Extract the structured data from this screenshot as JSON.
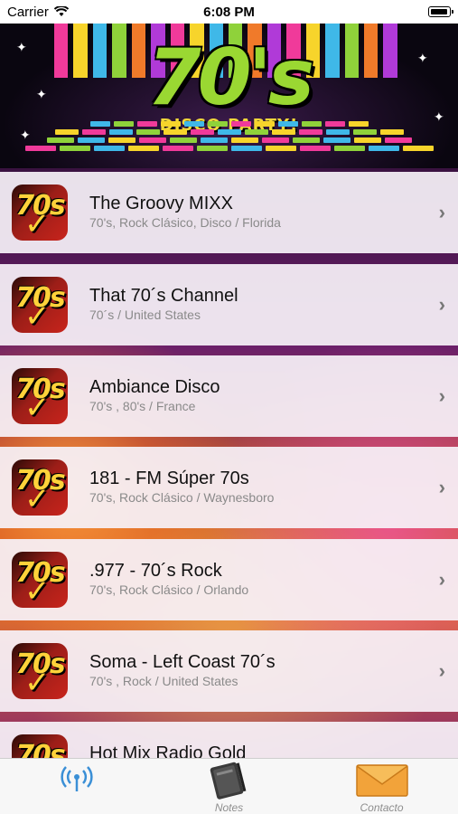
{
  "status_bar": {
    "carrier": "Carrier",
    "time": "6:08 PM"
  },
  "banner": {
    "title": "70's",
    "subtitle": "DISCO PARTY!"
  },
  "stations": [
    {
      "name": "The Groovy MIXX",
      "details": "70's, Rock Clásico, Disco / Florida",
      "icon": "70s-logo-icon"
    },
    {
      "name": "That 70´s Channel",
      "details": "70´s / United States",
      "icon": "70s-logo-icon"
    },
    {
      "name": "Ambiance Disco",
      "details": "70's , 80's / France",
      "icon": "70s-logo-icon"
    },
    {
      "name": "181 - FM Súper 70s",
      "details": "70's, Rock Clásico / Waynesboro",
      "icon": "70s-logo-icon"
    },
    {
      "name": ".977 - 70´s Rock",
      "details": "70's, Rock Clásico / Orlando",
      "icon": "70s-logo-icon"
    },
    {
      "name": "Soma - Left Coast 70´s",
      "details": "70's , Rock / United States",
      "icon": "70s-logo-icon"
    },
    {
      "name": "Hot Mix Radio Gold",
      "details": "",
      "icon": "70s-logo-icon"
    }
  ],
  "tabs": [
    {
      "label": "",
      "icon": "radio-antenna-icon",
      "active": true
    },
    {
      "label": "Notes",
      "icon": "notebook-icon",
      "active": false
    },
    {
      "label": "Contacto",
      "icon": "envelope-icon",
      "active": false
    }
  ],
  "colors": {
    "row_background": "#f6f1f7",
    "accent_blue": "#3a8fd6",
    "title_green": "#9ad832",
    "logo_yellow": "#ffd23a",
    "logo_red": "#c8241c"
  }
}
